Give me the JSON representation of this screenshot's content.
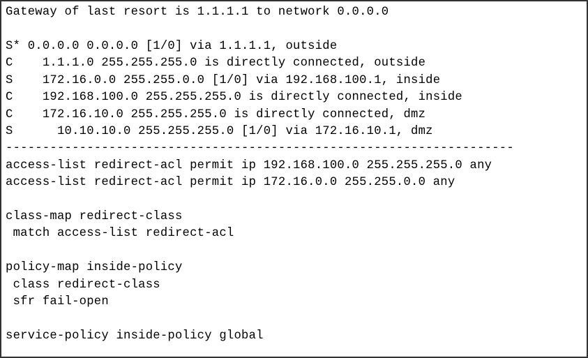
{
  "routing": {
    "gateway_line": "Gateway of last resort is 1.1.1.1 to network 0.0.0.0",
    "blank1": "",
    "routes": [
      "S* 0.0.0.0 0.0.0.0 [1/0] via 1.1.1.1, outside",
      "C    1.1.1.0 255.255.255.0 is directly connected, outside",
      "S    172.16.0.0 255.255.0.0 [1/0] via 192.168.100.1, inside",
      "C    192.168.100.0 255.255.255.0 is directly connected, inside",
      "C    172.16.10.0 255.255.255.0 is directly connected, dmz",
      "S      10.10.10.0 255.255.255.0 [1/0] via 172.16.10.1, dmz"
    ]
  },
  "separator": "---------------------------------------------------------------------",
  "acl": {
    "lines": [
      "access-list redirect-acl permit ip 192.168.100.0 255.255.255.0 any",
      "access-list redirect-acl permit ip 172.16.0.0 255.255.0.0 any"
    ]
  },
  "blank2": "",
  "class_map": {
    "header": "class-map redirect-class",
    "match": " match access-list redirect-acl"
  },
  "blank3": "",
  "policy_map": {
    "header": "policy-map inside-policy",
    "class_line": " class redirect-class",
    "sfr_line": " sfr fail-open"
  },
  "blank4": "",
  "service_policy": "service-policy inside-policy global"
}
